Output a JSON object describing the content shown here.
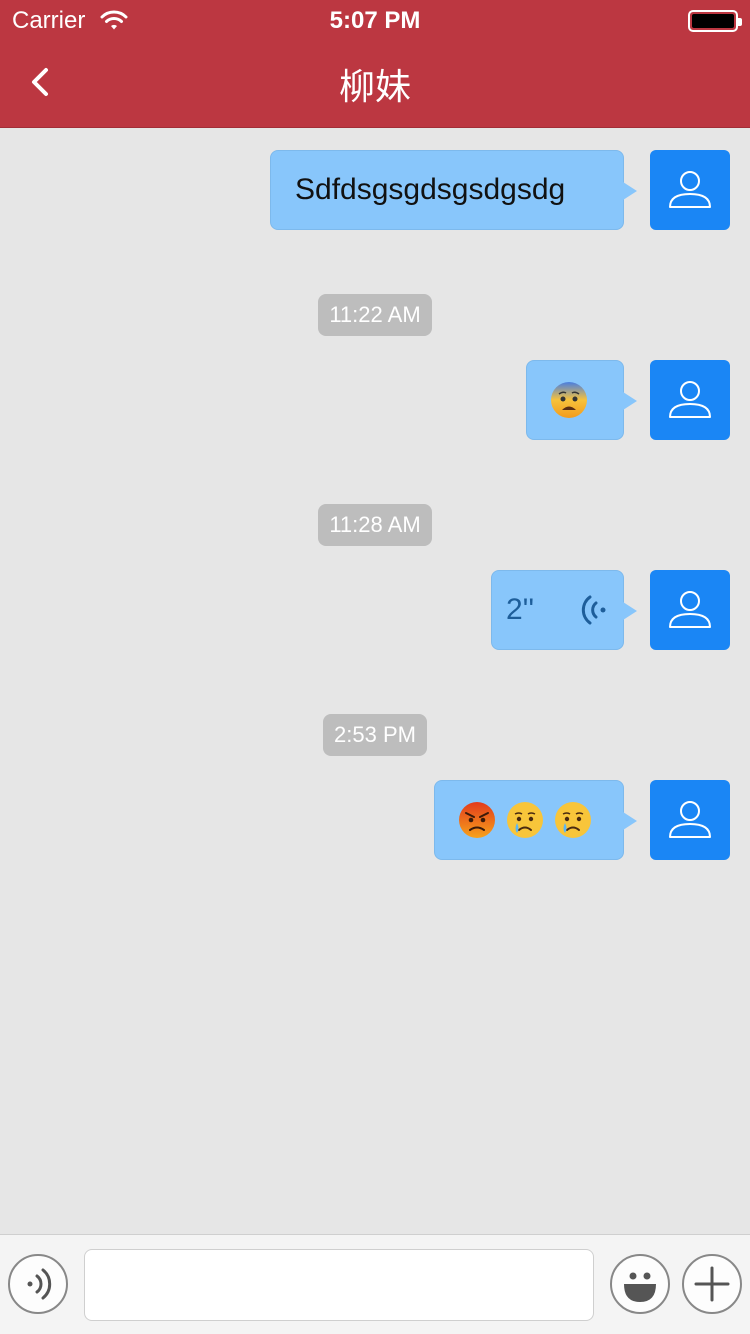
{
  "status_bar": {
    "carrier": "Carrier",
    "time": "5:07 PM"
  },
  "nav": {
    "title": "柳妹"
  },
  "messages": [
    {
      "type": "text",
      "text": "Sdfdsgsgdsgsdgsdg"
    },
    {
      "type": "timestamp",
      "text": "11:22 AM"
    },
    {
      "type": "emoji",
      "emojis": [
        "anxious-face"
      ]
    },
    {
      "type": "timestamp",
      "text": "11:28 AM"
    },
    {
      "type": "voice",
      "duration": "2''"
    },
    {
      "type": "timestamp",
      "text": "2:53 PM"
    },
    {
      "type": "emoji",
      "emojis": [
        "angry-face",
        "crying-face",
        "crying-face"
      ]
    }
  ],
  "input": {
    "placeholder": "",
    "value": ""
  },
  "icons": {
    "back": "chevron-left-icon",
    "avatar": "user-icon",
    "voice_toggle": "voice-icon",
    "emoji_button": "smiley-icon",
    "more_button": "plus-icon"
  },
  "colors": {
    "nav": "#bc3741",
    "bubble": "#88c6fb",
    "avatar": "#1a86f5",
    "background": "#e6e6e6"
  }
}
